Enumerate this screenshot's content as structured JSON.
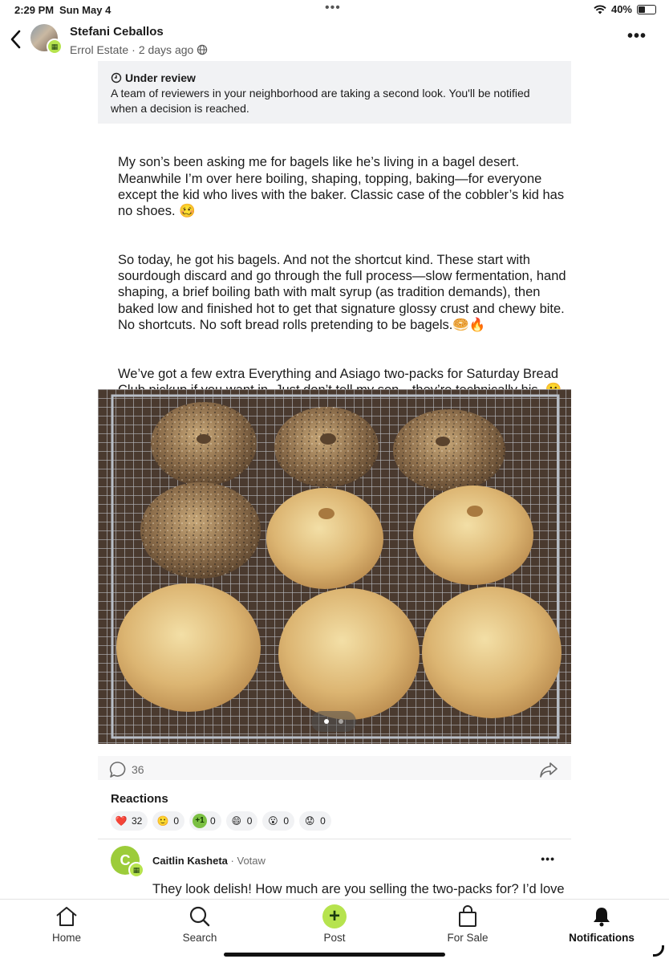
{
  "status_bar": {
    "time": "2:29 PM",
    "date": "Sun May 4",
    "battery": "40%",
    "battery_level": 0.4
  },
  "header": {
    "author": "Stefani Ceballos",
    "neighborhood": "Errol Estate",
    "time_ago": "2 days ago",
    "back_icon": "chevron-left-icon",
    "more_icon": "more-horizontal-icon"
  },
  "review": {
    "title": "Under review",
    "text": "A team of reviewers in your neighborhood are taking a second look. You'll be notified when a decision is reached."
  },
  "post": {
    "paragraph_1": "My son’s been asking me for bagels like he’s living in a bagel desert. Meanwhile I’m over here boiling, shaping, topping, baking—for everyone except the kid who lives with the baker. Classic case of the cobbler’s kid has no shoes. 🥴",
    "paragraph_2": "So today, he got his bagels. And not the shortcut kind. These start with sourdough discard and go through the full process—slow fermentation, hand shaping, a brief boiling bath with malt syrup (as tradition demands), then baked low and finished hot to get that signature glossy crust and chewy bite. No shortcuts. No soft bread rolls pretending to be bagels.🥯🔥",
    "paragraph_3": "We’ve got a few extra Everything and Asiago two-packs for Saturday Bread Club pickup if you want in. Just don’t tell my son—they’re technically his. 🤫😉",
    "photo_count": 2,
    "photo_current": 1
  },
  "actions": {
    "comment_count": "36"
  },
  "reactions": {
    "title": "Reactions",
    "items": [
      {
        "icon": "heart-icon",
        "emoji": "❤️",
        "count": "32",
        "color": "#e0245e"
      },
      {
        "icon": "smile-icon",
        "emoji": "🙂",
        "count": "0",
        "color": "#f5c518"
      },
      {
        "icon": "plus-one-icon",
        "emoji": "+1",
        "count": "0",
        "color": "#7bc043"
      },
      {
        "icon": "laugh-icon",
        "emoji": "😄",
        "count": "0",
        "color": "#f5c518"
      },
      {
        "icon": "wow-icon",
        "emoji": "😮",
        "count": "0",
        "color": "#f5c518"
      },
      {
        "icon": "sad-icon",
        "emoji": "😟",
        "count": "0",
        "color": "#f5c518"
      }
    ]
  },
  "comment": {
    "avatar_letter": "C",
    "author": "Caitlin Kasheta",
    "neighborhood": "Votaw",
    "text": "They look delish! How much are you selling the two-packs for? I’d love"
  },
  "tabs": [
    {
      "label": "Home",
      "icon": "home-icon"
    },
    {
      "label": "Search",
      "icon": "search-icon"
    },
    {
      "label": "Post",
      "icon": "plus-icon"
    },
    {
      "label": "For Sale",
      "icon": "shopping-bag-icon"
    },
    {
      "label": "Notifications",
      "icon": "bell-icon"
    }
  ],
  "colors": {
    "accent": "#b6e34e",
    "review_bg": "#f1f2f4"
  }
}
